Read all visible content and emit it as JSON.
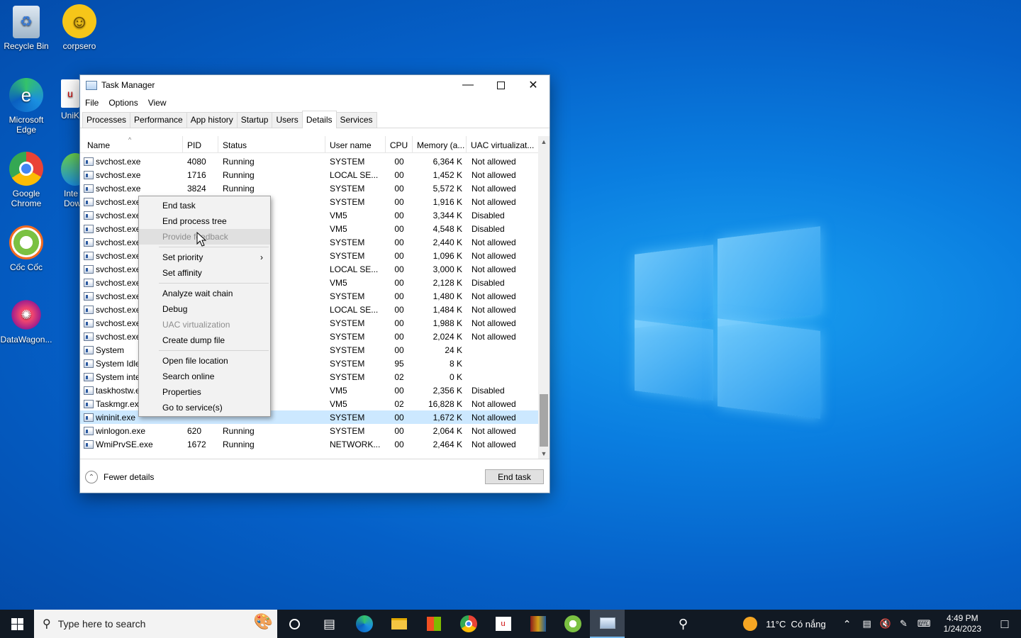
{
  "desktop": {
    "icons": [
      {
        "label": "Recycle Bin",
        "icon": "recycle-bin-icon"
      },
      {
        "label": "corpsero",
        "icon": "smiley-icon"
      },
      {
        "label": "Microsoft Edge",
        "icon": "edge-icon"
      },
      {
        "label": "UniK",
        "icon": "unikey-icon"
      },
      {
        "label": "Google Chrome",
        "icon": "chrome-icon"
      },
      {
        "label": "Inte Dow",
        "icon": "idm-icon"
      },
      {
        "label": "Cốc Cốc",
        "icon": "coccoc-icon"
      },
      {
        "label": "DataWagon...",
        "icon": "datawagon-icon"
      }
    ]
  },
  "window": {
    "title": "Task Manager",
    "menu": [
      "File",
      "Options",
      "View"
    ],
    "tabs": [
      "Processes",
      "Performance",
      "App history",
      "Startup",
      "Users",
      "Details",
      "Services"
    ],
    "active_tab": "Details"
  },
  "table": {
    "columns": [
      "Name",
      "PID",
      "Status",
      "User name",
      "CPU",
      "Memory (a...",
      "UAC virtualizat..."
    ],
    "rows": [
      {
        "name": "svchost.exe",
        "pid": "4080",
        "status": "Running",
        "user": "SYSTEM",
        "cpu": "00",
        "mem": "6,364 K",
        "uac": "Not allowed"
      },
      {
        "name": "svchost.exe",
        "pid": "1716",
        "status": "Running",
        "user": "LOCAL SE...",
        "cpu": "00",
        "mem": "1,452 K",
        "uac": "Not allowed"
      },
      {
        "name": "svchost.exe",
        "pid": "3824",
        "status": "Running",
        "user": "SYSTEM",
        "cpu": "00",
        "mem": "5,572 K",
        "uac": "Not allowed"
      },
      {
        "name": "svchost.exe",
        "pid": "",
        "status": "",
        "user": "SYSTEM",
        "cpu": "00",
        "mem": "1,916 K",
        "uac": "Not allowed"
      },
      {
        "name": "svchost.exe",
        "pid": "",
        "status": "",
        "user": "VM5",
        "cpu": "00",
        "mem": "3,344 K",
        "uac": "Disabled"
      },
      {
        "name": "svchost.exe",
        "pid": "",
        "status": "",
        "user": "VM5",
        "cpu": "00",
        "mem": "4,548 K",
        "uac": "Disabled"
      },
      {
        "name": "svchost.exe",
        "pid": "",
        "status": "",
        "user": "SYSTEM",
        "cpu": "00",
        "mem": "2,440 K",
        "uac": "Not allowed"
      },
      {
        "name": "svchost.exe",
        "pid": "",
        "status": "",
        "user": "SYSTEM",
        "cpu": "00",
        "mem": "1,096 K",
        "uac": "Not allowed"
      },
      {
        "name": "svchost.exe",
        "pid": "",
        "status": "",
        "user": "LOCAL SE...",
        "cpu": "00",
        "mem": "3,000 K",
        "uac": "Not allowed"
      },
      {
        "name": "svchost.exe",
        "pid": "",
        "status": "",
        "user": "VM5",
        "cpu": "00",
        "mem": "2,128 K",
        "uac": "Disabled"
      },
      {
        "name": "svchost.exe",
        "pid": "",
        "status": "",
        "user": "SYSTEM",
        "cpu": "00",
        "mem": "1,480 K",
        "uac": "Not allowed"
      },
      {
        "name": "svchost.exe",
        "pid": "",
        "status": "",
        "user": "LOCAL SE...",
        "cpu": "00",
        "mem": "1,484 K",
        "uac": "Not allowed"
      },
      {
        "name": "svchost.exe",
        "pid": "",
        "status": "",
        "user": "SYSTEM",
        "cpu": "00",
        "mem": "1,988 K",
        "uac": "Not allowed"
      },
      {
        "name": "svchost.exe",
        "pid": "",
        "status": "",
        "user": "SYSTEM",
        "cpu": "00",
        "mem": "2,024 K",
        "uac": "Not allowed"
      },
      {
        "name": "System",
        "pid": "",
        "status": "",
        "user": "SYSTEM",
        "cpu": "00",
        "mem": "24 K",
        "uac": ""
      },
      {
        "name": "System Idle",
        "pid": "",
        "status": "",
        "user": "SYSTEM",
        "cpu": "95",
        "mem": "8 K",
        "uac": ""
      },
      {
        "name": "System inte",
        "pid": "",
        "status": "",
        "user": "SYSTEM",
        "cpu": "02",
        "mem": "0 K",
        "uac": ""
      },
      {
        "name": "taskhostw.e",
        "pid": "",
        "status": "",
        "user": "VM5",
        "cpu": "00",
        "mem": "2,356 K",
        "uac": "Disabled"
      },
      {
        "name": "Taskmgr.ex",
        "pid": "",
        "status": "",
        "user": "VM5",
        "cpu": "02",
        "mem": "16,828 K",
        "uac": "Not allowed"
      },
      {
        "name": "wininit.exe",
        "pid": "",
        "status": "",
        "user": "SYSTEM",
        "cpu": "00",
        "mem": "1,672 K",
        "uac": "Not allowed",
        "selected": true
      },
      {
        "name": "winlogon.exe",
        "pid": "620",
        "status": "Running",
        "user": "SYSTEM",
        "cpu": "00",
        "mem": "2,064 K",
        "uac": "Not allowed"
      },
      {
        "name": "WmiPrvSE.exe",
        "pid": "1672",
        "status": "Running",
        "user": "NETWORK...",
        "cpu": "00",
        "mem": "2,464 K",
        "uac": "Not allowed"
      }
    ]
  },
  "footer": {
    "fewer_details": "Fewer details",
    "end_task": "End task"
  },
  "context_menu": {
    "items": [
      {
        "label": "End task",
        "enabled": true
      },
      {
        "label": "End process tree",
        "enabled": true
      },
      {
        "label": "Provide feedback",
        "enabled": false,
        "hover": true
      },
      {
        "sep": true
      },
      {
        "label": "Set priority",
        "enabled": true,
        "submenu": true
      },
      {
        "label": "Set affinity",
        "enabled": true
      },
      {
        "sep": true
      },
      {
        "label": "Analyze wait chain",
        "enabled": true
      },
      {
        "label": "Debug",
        "enabled": true
      },
      {
        "label": "UAC virtualization",
        "enabled": false
      },
      {
        "label": "Create dump file",
        "enabled": true
      },
      {
        "sep": true
      },
      {
        "label": "Open file location",
        "enabled": true
      },
      {
        "label": "Search online",
        "enabled": true
      },
      {
        "label": "Properties",
        "enabled": true
      },
      {
        "label": "Go to service(s)",
        "enabled": true
      }
    ]
  },
  "taskbar": {
    "search_placeholder": "Type here to search",
    "weather": "11°C  Có nắng",
    "time": "4:49 PM",
    "date": "1/24/2023"
  },
  "colors": {
    "selection": "#cce8ff",
    "taskbar": "#111923",
    "desktop_accent": "#0a7ee0"
  }
}
